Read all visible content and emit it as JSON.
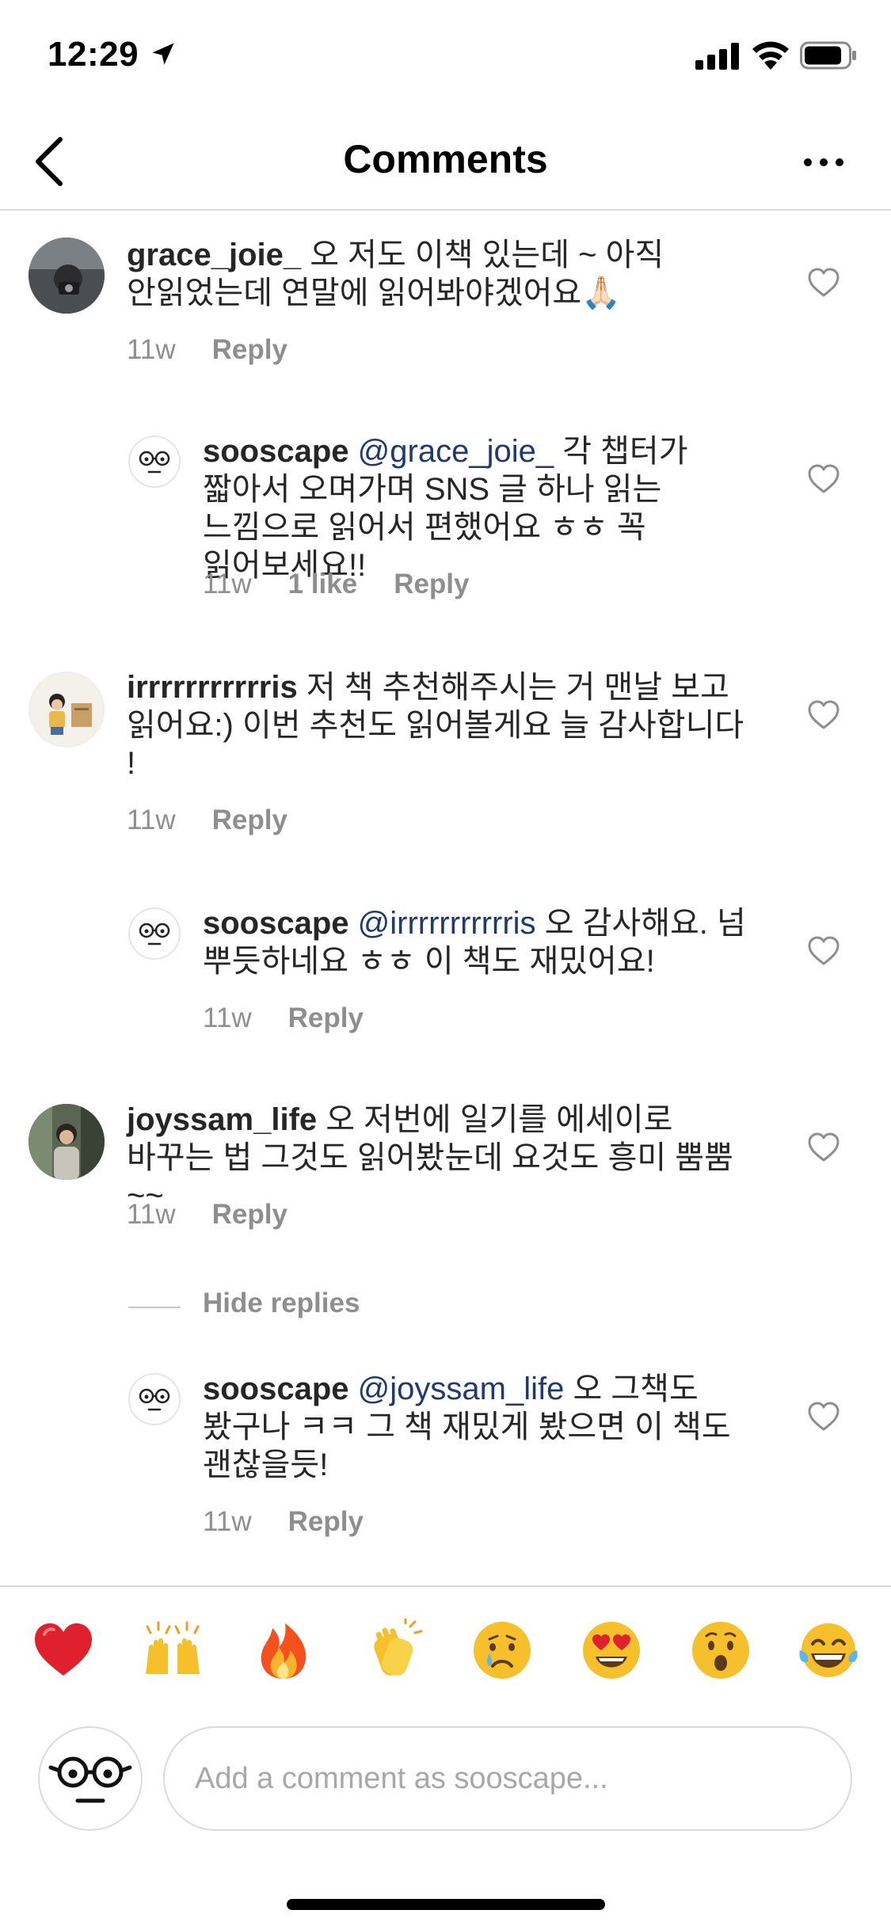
{
  "status_bar": {
    "time": "12:29"
  },
  "nav": {
    "title": "Comments"
  },
  "comments": [
    {
      "username": "grace_joie_",
      "text": "오 저도 이책 있는데 ~ 아직 안읽었는데 연말에 읽어봐야겠어요🙏🏻",
      "time": "11w",
      "reply_label": "Reply"
    },
    {
      "username": "sooscape",
      "mention": "@grace_joie_",
      "text": "각 챕터가 짧아서 오며가며 SNS 글 하나 읽는 느낌으로 읽어서 편했어요 ㅎㅎ 꼭 읽어보세요!!",
      "time": "11w",
      "likes": "1 like",
      "reply_label": "Reply"
    },
    {
      "username": "irrrrrrrrrrris",
      "text": "저 책 추천해주시는 거 맨날 보고 읽어요:) 이번 추천도 읽어볼게요 늘 감사합니다 !",
      "time": "11w",
      "reply_label": "Reply"
    },
    {
      "username": "sooscape",
      "mention": "@irrrrrrrrrrris",
      "text": "오 감사해요. 넘 뿌듯하네요 ㅎㅎ 이 책도 재밌어요!",
      "time": "11w",
      "reply_label": "Reply"
    },
    {
      "username": "joyssam_life",
      "text": "오 저번에 일기를 에세이로 바꾸는 법 그것도 읽어봤눈데 요것도 흥미 뿜뿜~~",
      "time": "11w",
      "reply_label": "Reply"
    },
    {
      "username": "sooscape",
      "mention": "@joyssam_life",
      "text": "오 그책도 봤구나 ㅋㅋ 그 책 재밌게 봤으면 이 책도 괜찮을듯!",
      "time": "11w",
      "reply_label": "Reply"
    }
  ],
  "hide_replies_label": "Hide replies",
  "emoji_bar": [
    "heart",
    "raising-hands",
    "fire",
    "clapping-hands",
    "crying-face",
    "heart-eyes-face",
    "surprised-face",
    "tears-of-joy-face"
  ],
  "composer": {
    "placeholder": "Add a comment as sooscape..."
  },
  "colors": {
    "text": "#262626",
    "secondary": "#8e8e8e",
    "mention": "#1e3a6e",
    "divider": "#dbdbdb"
  }
}
